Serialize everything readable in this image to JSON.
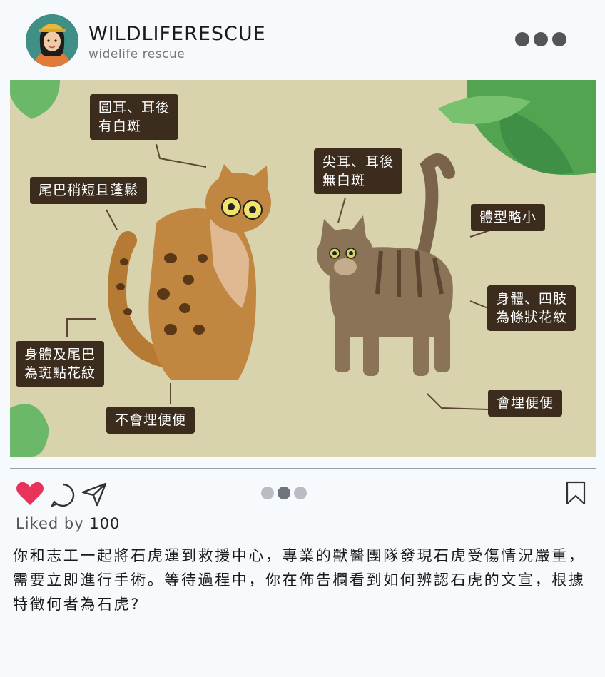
{
  "colors": {
    "heart": "#e8335a",
    "label_bg": "#3b2c1d",
    "poster_bg": "#d9d3ad"
  },
  "header": {
    "username": "WILDLIFERESCUE",
    "subtitle": "widelife rescue"
  },
  "post_image": {
    "labels": {
      "round_ears": "圓耳、耳後\n有白斑",
      "tail_short": "尾巴稍短且蓬鬆",
      "spots": "身體及尾巴\n為斑點花紋",
      "no_bury": "不會埋便便",
      "pointy_ears": "尖耳、耳後\n無白斑",
      "smaller": "體型略小",
      "stripes": "身體、四肢\n為條狀花紋",
      "bury": "會埋便便"
    }
  },
  "actions": {
    "like_icon": "heart-icon",
    "comment_icon": "comment-icon",
    "share_icon": "send-icon",
    "bookmark_icon": "bookmark-icon",
    "carousel_active_index": 2
  },
  "likes": {
    "prefix": "Liked by",
    "count": "100"
  },
  "caption": "你和志工一起將石虎運到救援中心，專業的獸醫團隊發現石虎受傷情況嚴重，需要立即進行手術。等待過程中，你在佈告欄看到如何辨認石虎的文宣，根據特徵何者為石虎?"
}
